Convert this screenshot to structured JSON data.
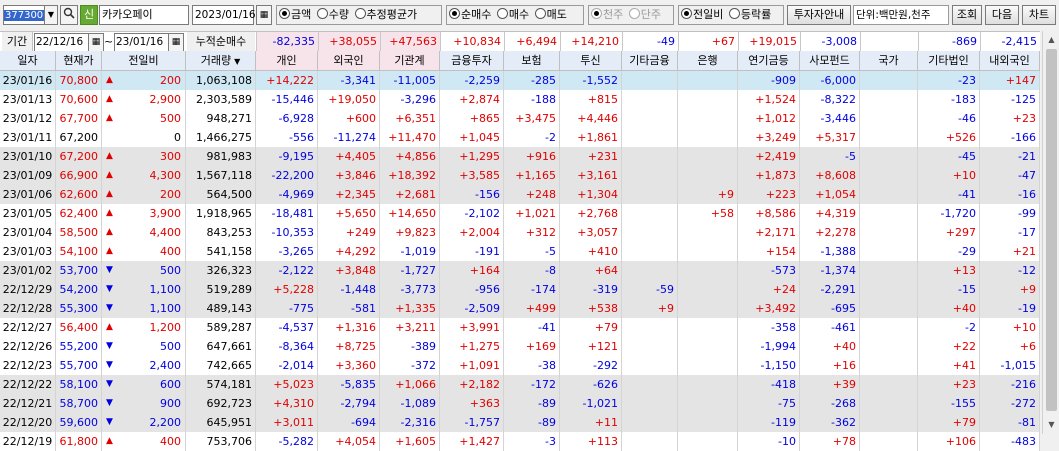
{
  "toolbar": {
    "code_value": "377300",
    "market_badge": "신",
    "stock_name": "카카오페이",
    "date_value": "2023/01/16",
    "unit_options": [
      {
        "label": "금액",
        "checked": true
      },
      {
        "label": "수량",
        "checked": false
      },
      {
        "label": "추정평균가",
        "checked": false
      }
    ],
    "trade_options": [
      {
        "label": "순매수",
        "checked": true
      },
      {
        "label": "매수",
        "checked": false
      },
      {
        "label": "매도",
        "checked": false
      }
    ],
    "scale_options": [
      {
        "label": "천주",
        "checked": true,
        "disabled": true
      },
      {
        "label": "단주",
        "checked": false,
        "disabled": true
      }
    ],
    "compare_options": [
      {
        "label": "전일비",
        "checked": true
      },
      {
        "label": "등락률",
        "checked": false
      }
    ],
    "investor_guide_label": "투자자안내",
    "unit_text": "단위:백만원,천주",
    "query_label": "조회",
    "next_label": "다음",
    "chart_label": "차트"
  },
  "period": {
    "label": "기간",
    "from": "22/12/16",
    "to": "23/01/16",
    "separator": "~",
    "cumulative_label": "누적순매수",
    "cumulative": [
      "-82,335",
      "+38,055",
      "+47,563",
      "+10,834",
      "+6,494",
      "+14,210",
      "-49",
      "+67",
      "+19,015",
      "-3,008",
      "",
      "-869",
      "-2,415"
    ]
  },
  "headers": [
    "일자",
    "현재가",
    "전일비",
    "거래량",
    "개인",
    "외국인",
    "기관계",
    "금융투자",
    "보험",
    "투신",
    "기타금융",
    "은행",
    "연기금등",
    "사모펀드",
    "국가",
    "기타법인",
    "내외국인"
  ],
  "rows": [
    [
      "23/01/16",
      "70,800",
      "up",
      "200",
      "1,063,108",
      "+14,222",
      "-3,341",
      "-11,005",
      "-2,259",
      "-285",
      "-1,552",
      "",
      "",
      "-909",
      "-6,000",
      "",
      "-23",
      "+147"
    ],
    [
      "23/01/13",
      "70,600",
      "up",
      "2,900",
      "2,303,589",
      "-15,446",
      "+19,050",
      "-3,296",
      "+2,874",
      "-188",
      "+815",
      "",
      "",
      "+1,524",
      "-8,322",
      "",
      "-183",
      "-125"
    ],
    [
      "23/01/12",
      "67,700",
      "up",
      "500",
      "948,271",
      "-6,928",
      "+600",
      "+6,351",
      "+865",
      "+3,475",
      "+4,446",
      "",
      "",
      "+1,012",
      "-3,446",
      "",
      "-46",
      "+23"
    ],
    [
      "23/01/11",
      "67,200",
      "",
      "0",
      "1,466,275",
      "-556",
      "-11,274",
      "+11,470",
      "+1,045",
      "-2",
      "+1,861",
      "",
      "",
      "+3,249",
      "+5,317",
      "",
      "+526",
      "-166"
    ],
    [
      "23/01/10",
      "67,200",
      "up",
      "300",
      "981,983",
      "-9,195",
      "+4,405",
      "+4,856",
      "+1,295",
      "+916",
      "+231",
      "",
      "",
      "+2,419",
      "-5",
      "",
      "-45",
      "-21"
    ],
    [
      "23/01/09",
      "66,900",
      "up",
      "4,300",
      "1,567,118",
      "-22,200",
      "+3,846",
      "+18,392",
      "+3,585",
      "+1,165",
      "+3,161",
      "",
      "",
      "+1,873",
      "+8,608",
      "",
      "+10",
      "-47"
    ],
    [
      "23/01/06",
      "62,600",
      "up",
      "200",
      "564,500",
      "-4,969",
      "+2,345",
      "+2,681",
      "-156",
      "+248",
      "+1,304",
      "",
      "+9",
      "+223",
      "+1,054",
      "",
      "-41",
      "-16"
    ],
    [
      "23/01/05",
      "62,400",
      "up",
      "3,900",
      "1,918,965",
      "-18,481",
      "+5,650",
      "+14,650",
      "-2,102",
      "+1,021",
      "+2,768",
      "",
      "+58",
      "+8,586",
      "+4,319",
      "",
      "-1,720",
      "-99"
    ],
    [
      "23/01/04",
      "58,500",
      "up",
      "4,400",
      "843,253",
      "-10,353",
      "+249",
      "+9,823",
      "+2,004",
      "+312",
      "+3,057",
      "",
      "",
      "+2,171",
      "+2,278",
      "",
      "+297",
      "-17"
    ],
    [
      "23/01/03",
      "54,100",
      "up",
      "400",
      "541,158",
      "-3,265",
      "+4,292",
      "-1,019",
      "-191",
      "-5",
      "+410",
      "",
      "",
      "+154",
      "-1,388",
      "",
      "-29",
      "+21"
    ],
    [
      "23/01/02",
      "53,700",
      "down",
      "500",
      "326,323",
      "-2,122",
      "+3,848",
      "-1,727",
      "+164",
      "-8",
      "+64",
      "",
      "",
      "-573",
      "-1,374",
      "",
      "+13",
      "-12"
    ],
    [
      "22/12/29",
      "54,200",
      "down",
      "1,100",
      "519,289",
      "+5,228",
      "-1,448",
      "-3,773",
      "-956",
      "-174",
      "-319",
      "-59",
      "",
      "+24",
      "-2,291",
      "",
      "-15",
      "+9"
    ],
    [
      "22/12/28",
      "55,300",
      "down",
      "1,100",
      "489,143",
      "-775",
      "-581",
      "+1,335",
      "-2,509",
      "+499",
      "+538",
      "+9",
      "",
      "+3,492",
      "-695",
      "",
      "+40",
      "-19"
    ],
    [
      "22/12/27",
      "56,400",
      "up",
      "1,200",
      "589,287",
      "-4,537",
      "+1,316",
      "+3,211",
      "+3,991",
      "-41",
      "+79",
      "",
      "",
      "-358",
      "-461",
      "",
      "-2",
      "+10"
    ],
    [
      "22/12/26",
      "55,200",
      "down",
      "500",
      "647,661",
      "-8,364",
      "+8,725",
      "-389",
      "+1,275",
      "+169",
      "+121",
      "",
      "",
      "-1,994",
      "+40",
      "",
      "+22",
      "+6"
    ],
    [
      "22/12/23",
      "55,700",
      "down",
      "2,400",
      "742,665",
      "-2,014",
      "+3,360",
      "-372",
      "+1,091",
      "-38",
      "-292",
      "",
      "",
      "-1,150",
      "+16",
      "",
      "+41",
      "-1,015"
    ],
    [
      "22/12/22",
      "58,100",
      "down",
      "600",
      "574,181",
      "+5,023",
      "-5,835",
      "+1,066",
      "+2,182",
      "-172",
      "-626",
      "",
      "",
      "-418",
      "+39",
      "",
      "+23",
      "-216"
    ],
    [
      "22/12/21",
      "58,700",
      "down",
      "900",
      "692,723",
      "+4,310",
      "-2,794",
      "-1,089",
      "+363",
      "-89",
      "-1,021",
      "",
      "",
      "-75",
      "-268",
      "",
      "-155",
      "-272"
    ],
    [
      "22/12/20",
      "59,600",
      "down",
      "2,200",
      "645,951",
      "+3,011",
      "-694",
      "-2,316",
      "-1,757",
      "-89",
      "+11",
      "",
      "",
      "-119",
      "-362",
      "",
      "+79",
      "-81"
    ],
    [
      "22/12/19",
      "61,800",
      "up",
      "400",
      "753,706",
      "-5,282",
      "+4,054",
      "+1,605",
      "+1,427",
      "-3",
      "+113",
      "",
      "",
      "-10",
      "+78",
      "",
      "+106",
      "-483"
    ]
  ],
  "colors": {
    "up": "#e00000",
    "down": "#0000e0",
    "selected_row": "#cfe8f3"
  }
}
